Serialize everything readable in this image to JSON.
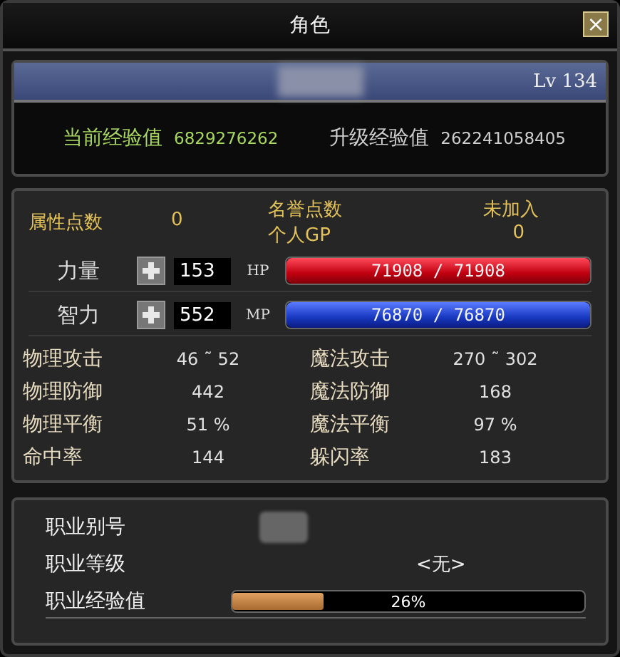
{
  "window": {
    "title": "角色",
    "close": "×"
  },
  "level_bar": {
    "level_text": "Lv 134"
  },
  "experience": [
    {
      "label": "当前经验值",
      "value": "6829276262",
      "kind": "current"
    },
    {
      "label": "升级经验值",
      "value": "262241058405",
      "kind": "next"
    }
  ],
  "points": {
    "attribute_label": "属性点数",
    "attribute_value": "0",
    "honor_label": "名誉点数",
    "honor_value": "未加入",
    "gp_label": "个人GP",
    "gp_value": "0"
  },
  "stats": [
    {
      "label": "力量",
      "value": "153",
      "bar_label": "HP",
      "bar_text": "71908 / 71908",
      "level": 1,
      "kind": "hp"
    },
    {
      "label": "智力",
      "value": "552",
      "bar_label": "MP",
      "bar_text": "76870 / 76870",
      "level": 1,
      "kind": "mp"
    }
  ],
  "attributes": [
    {
      "label": "物理攻击",
      "value": "46 ˜ 52"
    },
    {
      "label": "魔法攻击",
      "value": "270 ˜ 302"
    },
    {
      "label": "物理防御",
      "value": "442"
    },
    {
      "label": "魔法防御",
      "value": "168"
    },
    {
      "label": "物理平衡",
      "value": "51 %"
    },
    {
      "label": "魔法平衡",
      "value": "97 %"
    },
    {
      "label": "命中率",
      "value": "144"
    },
    {
      "label": "躲闪率",
      "value": "183"
    }
  ],
  "job": {
    "alias_label": "职业别号",
    "grade_label": "职业等级",
    "grade_value": "<无>",
    "exp_label": "职业经验值",
    "exp_text": "26%",
    "level": 0.26
  }
}
